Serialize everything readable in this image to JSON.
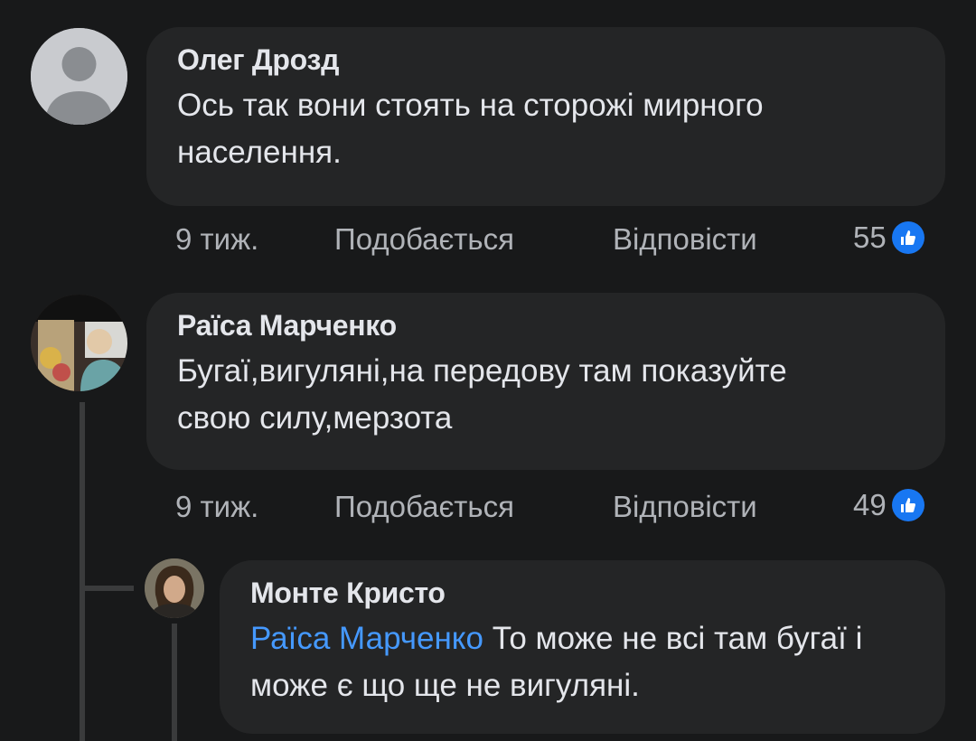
{
  "comments": [
    {
      "author": "Олег Дрозд",
      "text": "Ось так вони стоять на сторожі мирного населення.",
      "time": "9 тиж.",
      "like_label": "Подобається",
      "reply_label": "Відповісти",
      "likes": "55"
    },
    {
      "author": "Раїса Марченко",
      "text": "Бугаї,вигуляні,на передову там показуйте свою силу,мерзота",
      "time": "9 тиж.",
      "like_label": "Подобається",
      "reply_label": "Відповісти",
      "likes": "49"
    }
  ],
  "reply": {
    "author": "Монте Кристо",
    "mention": "Раїса Марченко",
    "text": "То може не всі там бугаї і може є що ще не вигуляні."
  },
  "colors": {
    "background": "#18191a",
    "bubble": "#242526",
    "mention": "#4599ff",
    "like_badge": "#1877f2"
  }
}
